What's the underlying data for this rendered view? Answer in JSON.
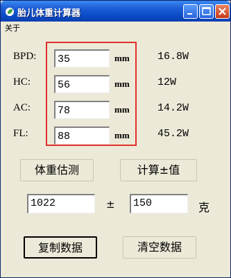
{
  "window": {
    "title": "胎儿体重计算器",
    "titlebar_color": "#0b4cc7",
    "app_icon": "leaf-icon",
    "controls": [
      "minimize-icon",
      "maximize-icon",
      "close-icon"
    ]
  },
  "menu": {
    "about": "关于"
  },
  "measurements": [
    {
      "label": "BPD:",
      "value": "35",
      "unit": "mm",
      "result": "16.8W"
    },
    {
      "label": "HC:",
      "value": "56",
      "unit": "mm",
      "result": "12W"
    },
    {
      "label": "AC:",
      "value": "78",
      "unit": "mm",
      "result": "14.2W"
    },
    {
      "label": "FL:",
      "value": "88",
      "unit": "mm",
      "result": "45.2W"
    }
  ],
  "buttons": {
    "estimate": "体重估测",
    "calc_range": "计算±值",
    "copy": "复制数据",
    "clear": "清空数据"
  },
  "estimate": {
    "weight": "1022",
    "pm_symbol": "±",
    "range": "150",
    "unit": "克"
  },
  "highlight_color": "#e0302a"
}
